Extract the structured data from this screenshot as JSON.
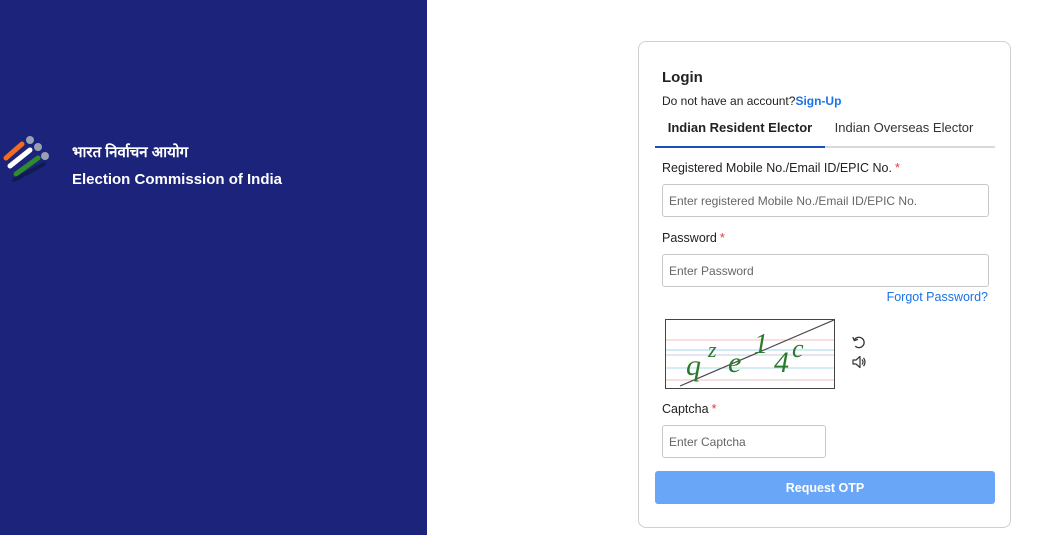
{
  "brand": {
    "hindi_name": "भारत निर्वाचन आयोग",
    "english_name": "Election Commission of India",
    "logo_icon": "eci-ballot-finger-icon",
    "colors": {
      "panel": "#1b237a",
      "saffron": "#f26b21",
      "green": "#2e8b2e"
    }
  },
  "login": {
    "title": "Login",
    "signup_prompt": "Do not have an account?",
    "signup_link": "Sign-Up",
    "tabs": [
      {
        "label": "Indian Resident Elector",
        "active": true
      },
      {
        "label": "Indian Overseas Elector",
        "active": false
      }
    ],
    "fields": {
      "id": {
        "label": "Registered Mobile No./Email ID/EPIC No.",
        "required_mark": "*",
        "placeholder": "Enter registered Mobile No./Email ID/EPIC No.",
        "value": ""
      },
      "password": {
        "label": "Password",
        "required_mark": "*",
        "placeholder": "Enter Password",
        "value": ""
      },
      "captcha": {
        "label": "Captcha",
        "required_mark": "*",
        "placeholder": "Enter Captcha",
        "value": ""
      }
    },
    "forgot_password": "Forgot Password?",
    "captcha_image": {
      "text": "qze14c",
      "refresh_icon": "refresh-icon",
      "audio_icon": "speaker-icon"
    },
    "submit_label": "Request OTP",
    "colors": {
      "accent": "#1a73e8",
      "button": "#6aa6f8",
      "required": "#e53935"
    }
  }
}
